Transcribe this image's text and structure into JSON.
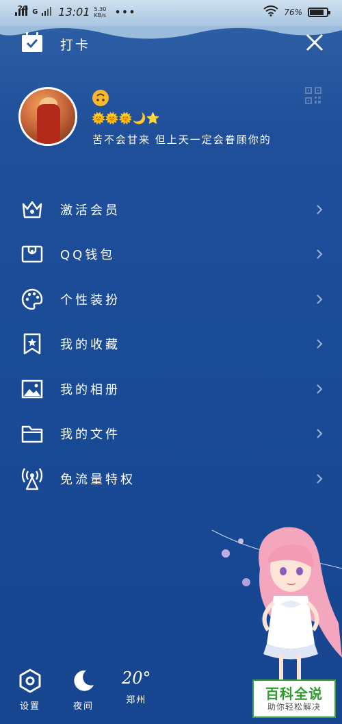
{
  "status_bar": {
    "network_1": "2G",
    "network_2": "G",
    "time": "13:01",
    "speed_value": "5.30",
    "speed_unit": "KB/s",
    "more": "•••",
    "battery": "76%",
    "battery_level": 0.76
  },
  "top": {
    "checkin_label": "打卡"
  },
  "profile": {
    "level_icons": "🌞🌞🌞🌙⭐",
    "signature": "苦不会甘来 但上天一定会眷顾你的"
  },
  "menu": {
    "items": [
      {
        "label": "激活会员"
      },
      {
        "label": "QQ钱包"
      },
      {
        "label": "个性装扮"
      },
      {
        "label": "我的收藏"
      },
      {
        "label": "我的相册"
      },
      {
        "label": "我的文件"
      },
      {
        "label": "免流量特权"
      }
    ]
  },
  "bottom": {
    "settings_label": "设置",
    "night_label": "夜间",
    "temperature": "20°",
    "city": "郑州"
  },
  "watermark": {
    "title": "百科全说",
    "subtitle": "助你轻松解决"
  },
  "colors": {
    "background": "#1a4b96",
    "accent_watermark": "#2e9b2e"
  }
}
